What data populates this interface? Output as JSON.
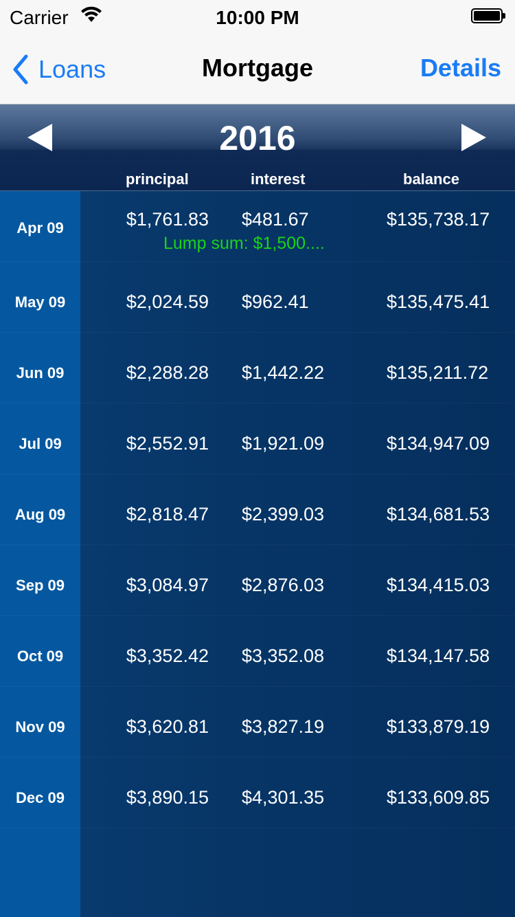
{
  "status_bar": {
    "carrier": "Carrier",
    "time": "10:00 PM"
  },
  "nav": {
    "back_label": "Loans",
    "title": "Mortgage",
    "details_label": "Details",
    "accent_color": "#1a7cf5"
  },
  "schedule": {
    "year": "2016",
    "columns": {
      "principal": "principal",
      "interest": "interest",
      "balance": "balance"
    },
    "rows": [
      {
        "month": "Apr 09",
        "principal": "$1,761.83",
        "interest": "$481.67",
        "balance": "$135,738.17",
        "note": "Lump sum: $1,500...."
      },
      {
        "month": "May 09",
        "principal": "$2,024.59",
        "interest": "$962.41",
        "balance": "$135,475.41"
      },
      {
        "month": "Jun 09",
        "principal": "$2,288.28",
        "interest": "$1,442.22",
        "balance": "$135,211.72"
      },
      {
        "month": "Jul 09",
        "principal": "$2,552.91",
        "interest": "$1,921.09",
        "balance": "$134,947.09"
      },
      {
        "month": "Aug 09",
        "principal": "$2,818.47",
        "interest": "$2,399.03",
        "balance": "$134,681.53"
      },
      {
        "month": "Sep 09",
        "principal": "$3,084.97",
        "interest": "$2,876.03",
        "balance": "$134,415.03"
      },
      {
        "month": "Oct 09",
        "principal": "$3,352.42",
        "interest": "$3,352.08",
        "balance": "$134,147.58"
      },
      {
        "month": "Nov 09",
        "principal": "$3,620.81",
        "interest": "$3,827.19",
        "balance": "$133,879.19"
      },
      {
        "month": "Dec 09",
        "principal": "$3,890.15",
        "interest": "$4,301.35",
        "balance": "$133,609.85"
      }
    ],
    "note_color": "#19d31a"
  },
  "icons": {
    "back": "chevron-left-icon",
    "prev_year": "triangle-left-icon",
    "next_year": "triangle-right-icon",
    "wifi": "wifi-icon",
    "battery": "battery-icon"
  }
}
